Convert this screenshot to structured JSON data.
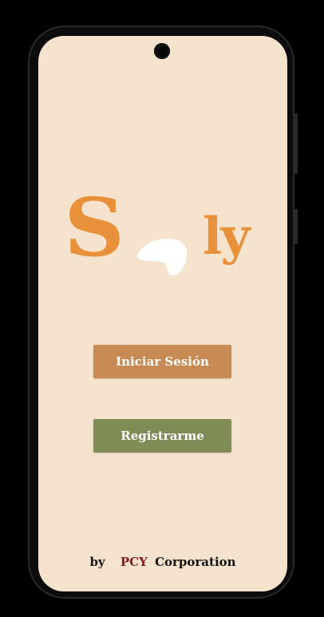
{
  "app": {
    "logo_first": "S",
    "logo_last": "ly"
  },
  "buttons": {
    "login_label": "Iniciar Sesión",
    "register_label": "Registrarme"
  },
  "footer": {
    "by": "by",
    "company_highlight": "PCY",
    "company_rest": "Corporation"
  },
  "colors": {
    "background": "#f5e3cd",
    "logo": "#e8913a",
    "login_button": "#c88a55",
    "register_button": "#7f8c55",
    "pcy_text": "#8b1a1a"
  }
}
